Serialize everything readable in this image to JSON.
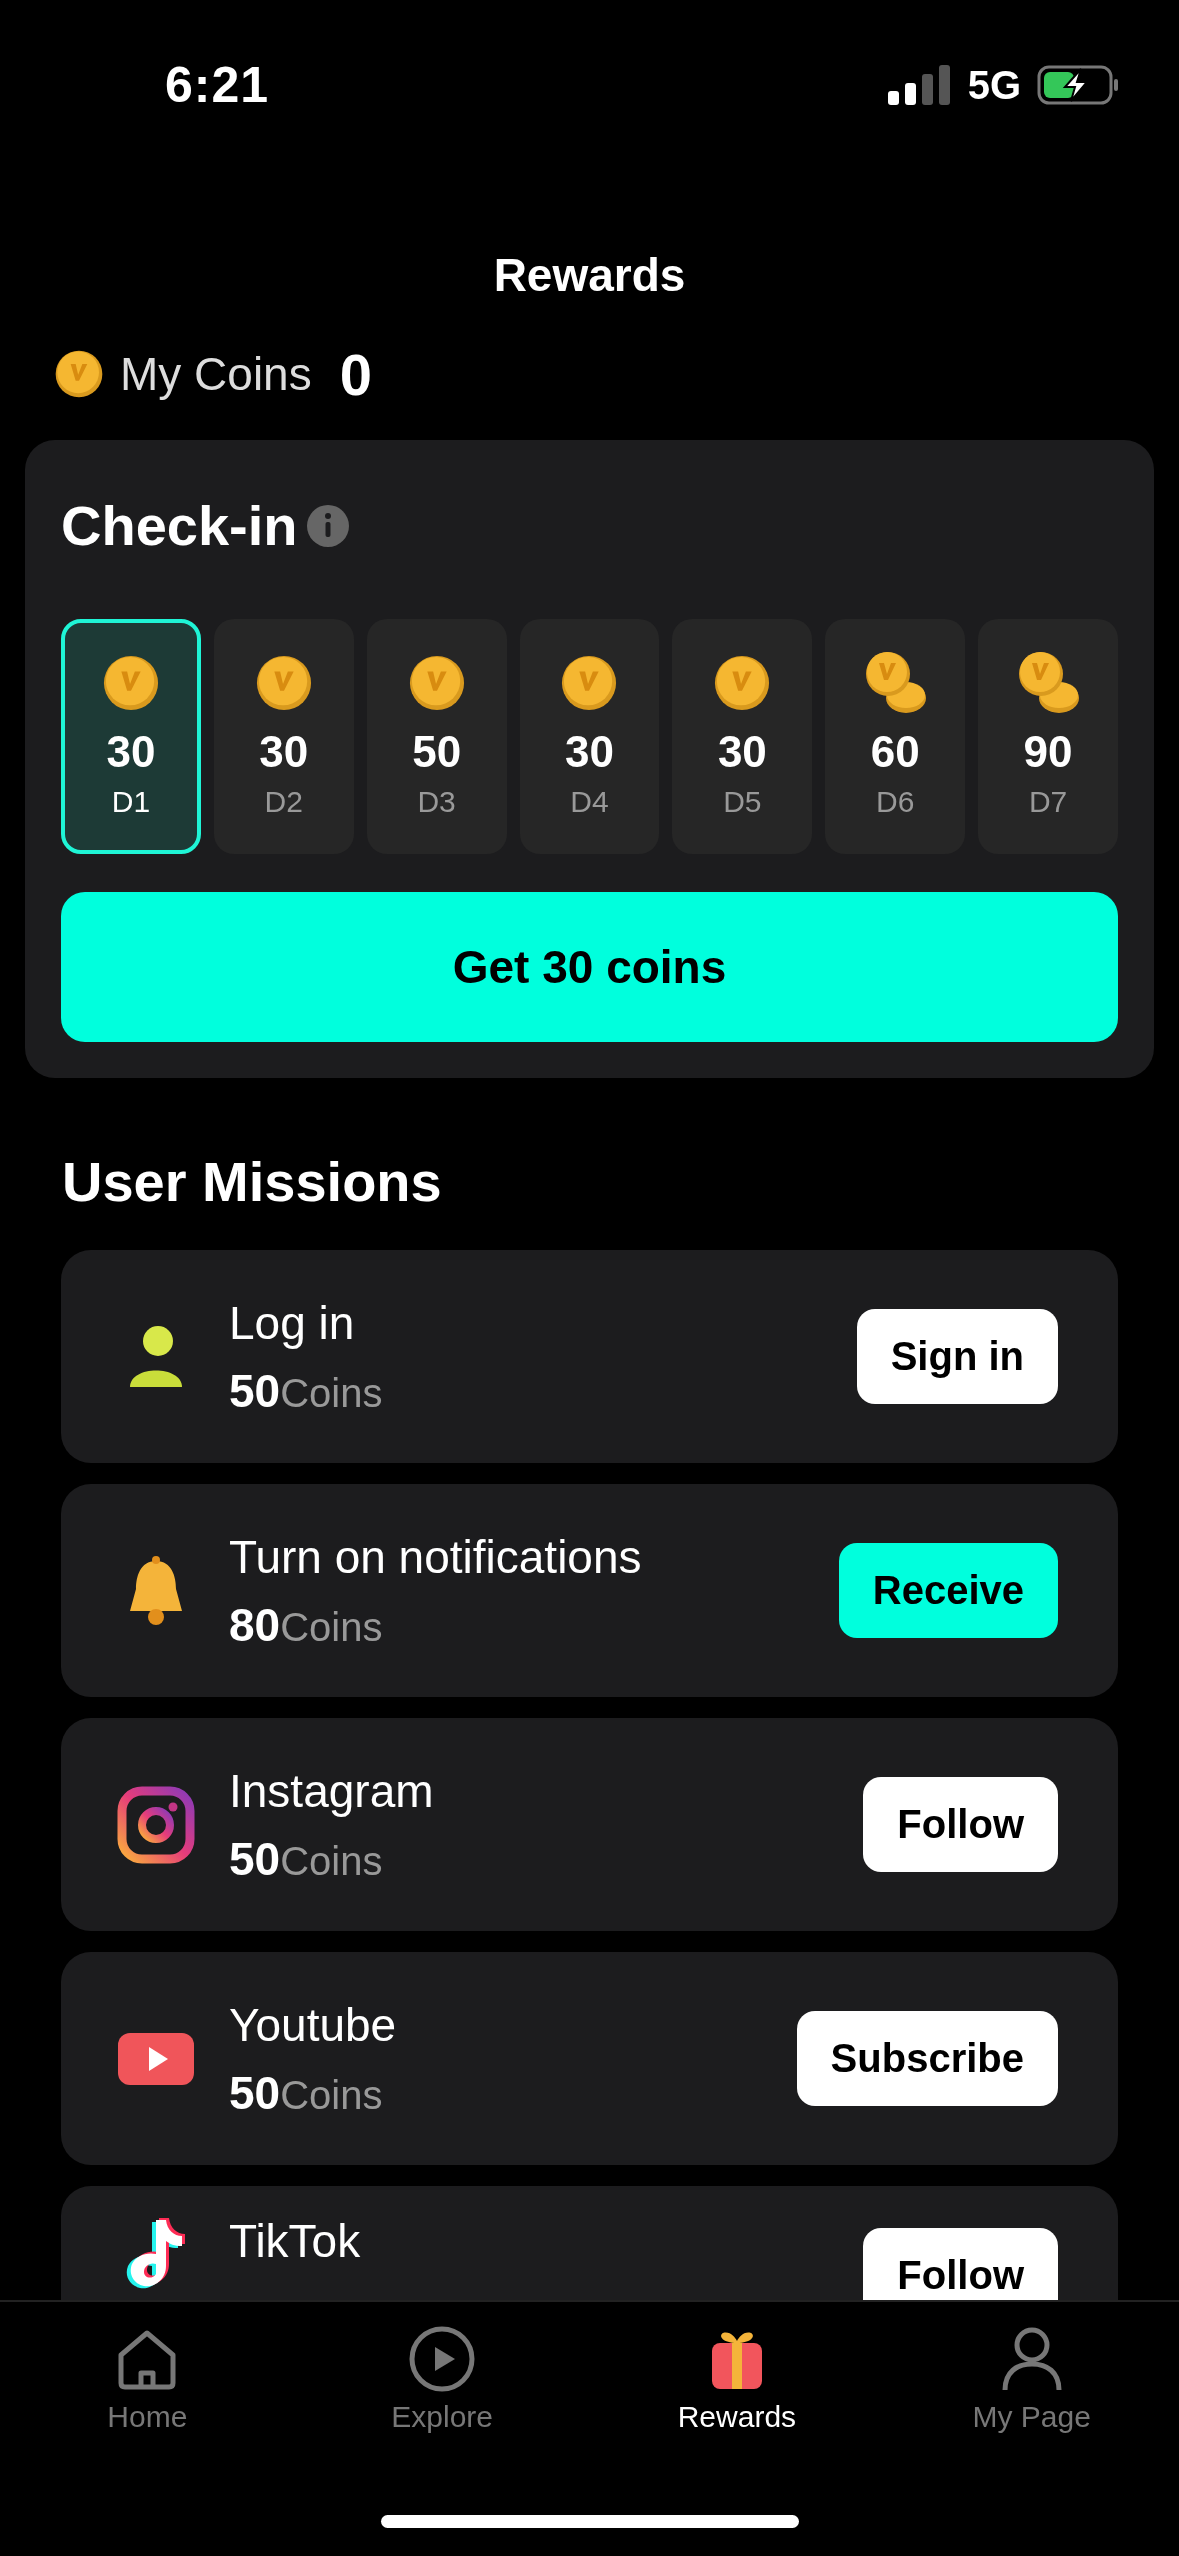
{
  "status_bar": {
    "time": "6:21",
    "network": "5G"
  },
  "title": "Rewards",
  "my_coins": {
    "label": "My Coins",
    "value": "0"
  },
  "check_in": {
    "title": "Check-in",
    "days": [
      {
        "coins": "30",
        "label": "D1",
        "kind": "single",
        "selected": true
      },
      {
        "coins": "30",
        "label": "D2",
        "kind": "single",
        "selected": false
      },
      {
        "coins": "50",
        "label": "D3",
        "kind": "single",
        "selected": false
      },
      {
        "coins": "30",
        "label": "D4",
        "kind": "single",
        "selected": false
      },
      {
        "coins": "30",
        "label": "D5",
        "kind": "single",
        "selected": false
      },
      {
        "coins": "60",
        "label": "D6",
        "kind": "double",
        "selected": false
      },
      {
        "coins": "90",
        "label": "D7",
        "kind": "double",
        "selected": false
      }
    ],
    "button": "Get 30 coins"
  },
  "missions": {
    "title": "User Missions",
    "items": [
      {
        "kind": "person",
        "name": "Log in",
        "reward": "50",
        "unit": "Coins",
        "button": "Sign in",
        "highlighted": false
      },
      {
        "kind": "bell",
        "name": "Turn on notifications",
        "reward": "80",
        "unit": "Coins",
        "button": "Receive",
        "highlighted": true
      },
      {
        "kind": "instagram",
        "name": "Instagram",
        "reward": "50",
        "unit": "Coins",
        "button": "Follow",
        "highlighted": false
      },
      {
        "kind": "youtube",
        "name": "Youtube",
        "reward": "50",
        "unit": "Coins",
        "button": "Subscribe",
        "highlighted": false
      },
      {
        "kind": "tiktok",
        "name": "TikTok",
        "button": "Follow",
        "highlighted": false
      }
    ]
  },
  "tab_bar": [
    {
      "kind": "home",
      "label": "Home",
      "selected": false
    },
    {
      "kind": "explore",
      "label": "Explore",
      "selected": false
    },
    {
      "kind": "rewards",
      "label": "Rewards",
      "selected": true
    },
    {
      "kind": "profile",
      "label": "My Page",
      "selected": false
    }
  ]
}
